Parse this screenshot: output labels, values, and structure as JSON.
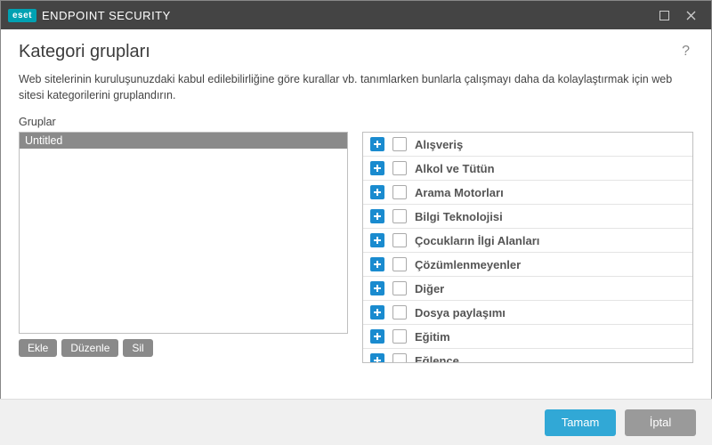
{
  "titlebar": {
    "brand_badge": "eset",
    "brand_title": "ENDPOINT SECURITY"
  },
  "page": {
    "title": "Kategori grupları",
    "description": "Web sitelerinin kuruluşunuzdaki kabul edilebilirliğine göre kurallar vb. tanımlarken bunlarla çalışmayı daha da kolaylaştırmak için web sitesi kategorilerini gruplandırın.",
    "groups_label": "Gruplar"
  },
  "groups": {
    "items": [
      {
        "name": "Untitled"
      }
    ],
    "actions": {
      "add": "Ekle",
      "edit": "Düzenle",
      "delete": "Sil"
    }
  },
  "categories": [
    {
      "label": "Alışveriş"
    },
    {
      "label": "Alkol ve Tütün"
    },
    {
      "label": "Arama Motorları"
    },
    {
      "label": "Bilgi Teknolojisi"
    },
    {
      "label": "Çocukların İlgi Alanları"
    },
    {
      "label": "Çözümlenmeyenler"
    },
    {
      "label": "Diğer"
    },
    {
      "label": "Dosya paylaşımı"
    },
    {
      "label": "Eğitim"
    },
    {
      "label": "Eğlence"
    }
  ],
  "footer": {
    "ok": "Tamam",
    "cancel": "İptal"
  }
}
